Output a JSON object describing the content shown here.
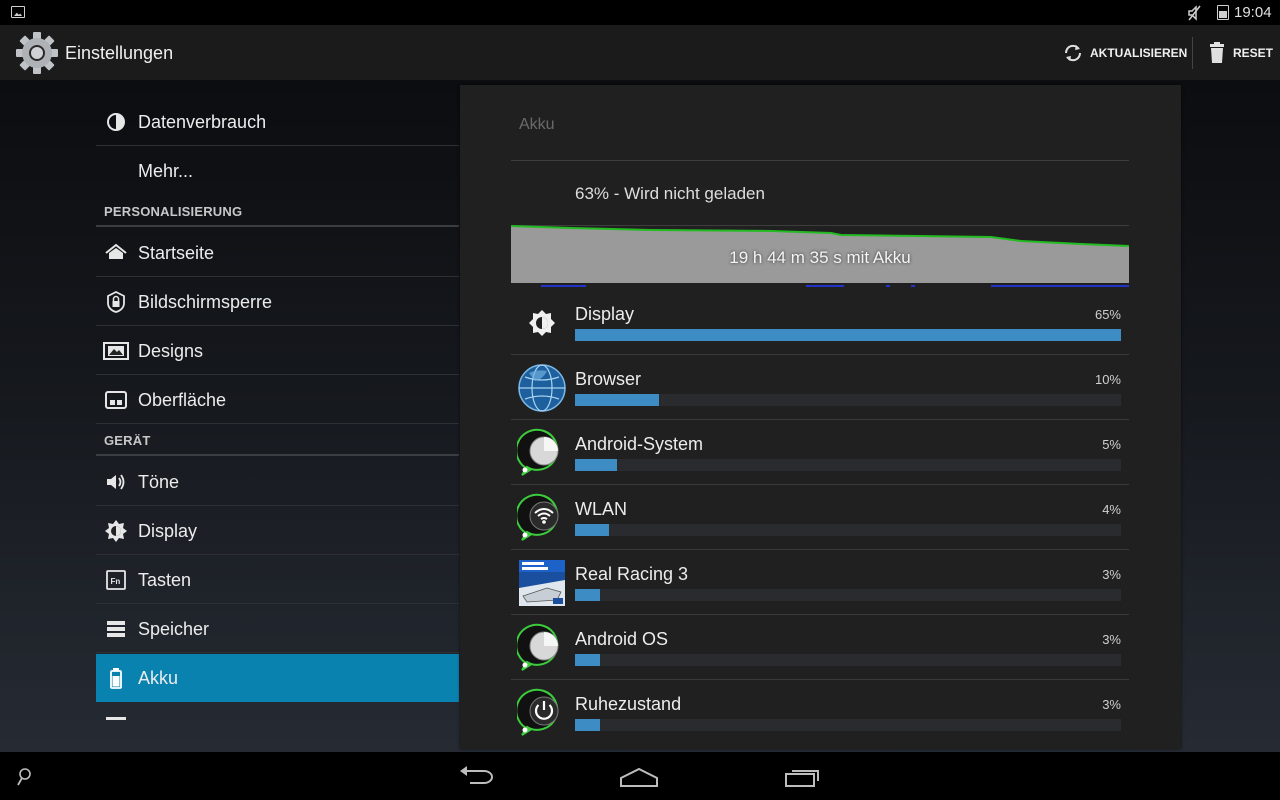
{
  "status_bar": {
    "time": "19:04",
    "left_icon": "image-notification-icon",
    "mute_icon": "muted-icon",
    "battery_icon": "battery-icon"
  },
  "action_bar": {
    "title": "Einstellungen",
    "app_icon": "settings-gear-icon",
    "refresh_label": "AKTUALISIEREN",
    "reset_label": "RESET"
  },
  "sidebar": {
    "items": [
      {
        "type": "row",
        "label": "Datenverbrauch",
        "icon": "data-usage-icon"
      },
      {
        "type": "row",
        "label": "Mehr...",
        "icon": ""
      },
      {
        "type": "header",
        "label": "PERSONALISIERUNG"
      },
      {
        "type": "row",
        "label": "Startseite",
        "icon": "home-icon"
      },
      {
        "type": "row",
        "label": "Bildschirmsperre",
        "icon": "lock-icon"
      },
      {
        "type": "row",
        "label": "Designs",
        "icon": "designs-icon"
      },
      {
        "type": "row",
        "label": "Oberfläche",
        "icon": "interface-icon"
      },
      {
        "type": "header",
        "label": "GERÄT"
      },
      {
        "type": "row",
        "label": "Töne",
        "icon": "volume-icon"
      },
      {
        "type": "row",
        "label": "Display",
        "icon": "brightness-icon"
      },
      {
        "type": "row",
        "label": "Tasten",
        "icon": "fn-key-icon"
      },
      {
        "type": "row",
        "label": "Speicher",
        "icon": "storage-icon"
      },
      {
        "type": "row",
        "label": "Akku",
        "icon": "battery-icon",
        "active": true
      }
    ]
  },
  "panel": {
    "title": "Akku",
    "status": "63% - Wird nicht geladen",
    "graph_label": "19 h 44 m 35 s mit Akku",
    "usage": [
      {
        "name": "Display",
        "percent": "65%",
        "value": 65,
        "icon": "display-brightness-icon"
      },
      {
        "name": "Browser",
        "percent": "10%",
        "value": 10,
        "icon": "browser-globe-icon"
      },
      {
        "name": "Android-System",
        "percent": "5%",
        "value": 5,
        "icon": "android-system-icon"
      },
      {
        "name": "WLAN",
        "percent": "4%",
        "value": 4,
        "icon": "wifi-icon"
      },
      {
        "name": "Real Racing 3",
        "percent": "3%",
        "value": 3,
        "icon": "real-racing-3-icon"
      },
      {
        "name": "Android OS",
        "percent": "3%",
        "value": 3,
        "icon": "android-os-icon"
      },
      {
        "name": "Ruhezustand",
        "percent": "3%",
        "value": 3,
        "icon": "standby-power-icon"
      }
    ]
  },
  "colors": {
    "accent": "#0a82b0",
    "bar_fill": "#3d8cc4",
    "graph_line": "#22bb22"
  },
  "nav_bar": {
    "search_icon": "search-icon",
    "back_icon": "back-icon",
    "home_icon": "home-nav-icon",
    "recents_icon": "recent-apps-icon"
  }
}
